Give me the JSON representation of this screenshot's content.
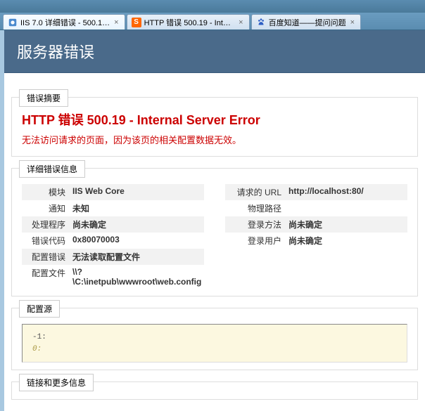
{
  "tabs": [
    {
      "title": "IIS 7.0 详细错误 - 500.1…",
      "active": true
    },
    {
      "title": "HTTP 错误 500.19 - Inte…",
      "active": false
    },
    {
      "title": "百度知道——提问问题",
      "active": false
    }
  ],
  "header": {
    "title": "服务器错误"
  },
  "summary": {
    "tab": "错误摘要",
    "title": "HTTP 错误  500.19 - Internal Server Error",
    "desc": "无法访问请求的页面，因为该页的相关配置数据无效。"
  },
  "detail": {
    "tab": "详细错误信息",
    "left": [
      {
        "label": "模块",
        "value": "IIS Web Core"
      },
      {
        "label": "通知",
        "value": "未知"
      },
      {
        "label": "处理程序",
        "value": "尚未确定"
      },
      {
        "label": "错误代码",
        "value": "0x80070003"
      },
      {
        "label": "配置错误",
        "value": "无法读取配置文件"
      },
      {
        "label": "配置文件",
        "value": "\\\\?\\C:\\inetpub\\wwwroot\\web.config"
      }
    ],
    "right": [
      {
        "label": "请求的 URL",
        "value": "http://localhost:80/"
      },
      {
        "label": "物理路径",
        "value": ""
      },
      {
        "label": "登录方法",
        "value": "尚未确定"
      },
      {
        "label": "登录用户",
        "value": "尚未确定"
      }
    ]
  },
  "config": {
    "tab": "配置源",
    "lines": [
      "   -1:",
      "    0:"
    ]
  },
  "links": {
    "tab": "链接和更多信息"
  }
}
